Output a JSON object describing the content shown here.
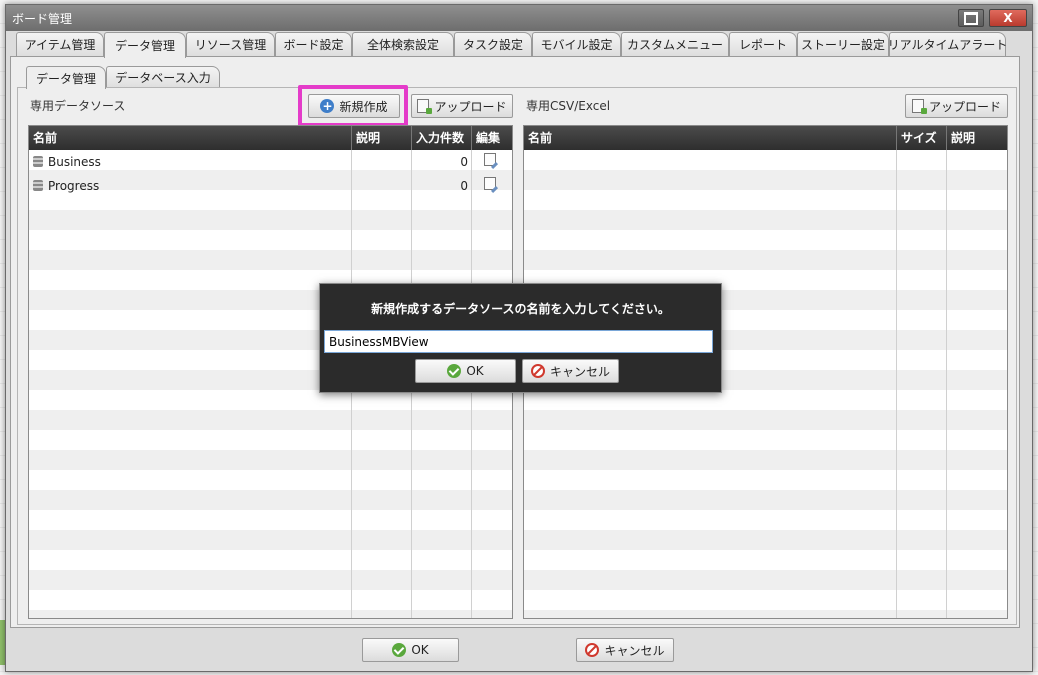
{
  "window": {
    "title": "ボード管理"
  },
  "tabs_top": [
    {
      "label": "アイテム管理"
    },
    {
      "label": "データ管理"
    },
    {
      "label": "リソース管理"
    },
    {
      "label": "ボード設定"
    },
    {
      "label": "全体検索設定"
    },
    {
      "label": "タスク設定"
    },
    {
      "label": "モバイル設定"
    },
    {
      "label": "カスタムメニュー"
    },
    {
      "label": "レポート"
    },
    {
      "label": "ストーリー設定"
    },
    {
      "label": "リアルタイムアラート"
    }
  ],
  "tabs_sub": [
    {
      "label": "データ管理"
    },
    {
      "label": "データベース入力"
    }
  ],
  "left": {
    "section_label": "専用データソース",
    "new_button": "新規作成",
    "upload_button": "アップロード",
    "columns": [
      "名前",
      "説明",
      "入力件数",
      "編集"
    ],
    "rows": [
      {
        "name": "Business",
        "desc": "",
        "count": "0"
      },
      {
        "name": "Progress",
        "desc": "",
        "count": "0"
      }
    ]
  },
  "right": {
    "section_label": "専用CSV/Excel",
    "upload_button": "アップロード",
    "columns": [
      "名前",
      "サイズ",
      "説明"
    ]
  },
  "dialog": {
    "message": "新規作成するデータソースの名前を入力してください。",
    "input_value": "BusinessMBView",
    "ok": "OK",
    "cancel": "キャンセル"
  },
  "footer": {
    "ok": "OK",
    "cancel": "キャンセル"
  },
  "colors": {
    "highlight": "#e43bc9",
    "grid_header": "#3a3a3a"
  }
}
